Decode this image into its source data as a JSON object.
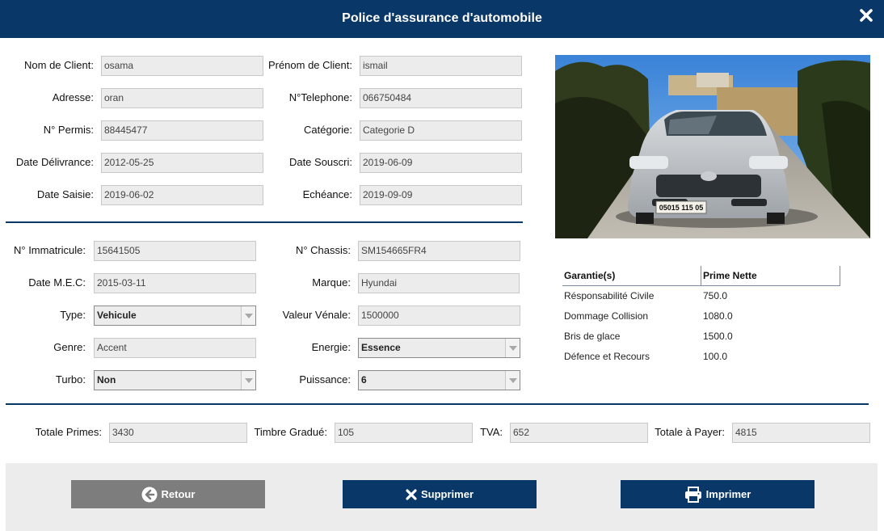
{
  "window": {
    "title": "Police d'assurance d'automobile"
  },
  "client": {
    "nom_label": "Nom de Client:",
    "nom_value": "osama",
    "prenom_label": "Prénom de Client:",
    "prenom_value": "ismail",
    "adresse_label": "Adresse:",
    "adresse_value": "oran",
    "telephone_label": "N°Telephone:",
    "telephone_value": "066750484",
    "permis_label": "N° Permis:",
    "permis_value": "88445477",
    "categorie_label": "Catégorie:",
    "categorie_value": "Categorie D",
    "delivrance_label": "Date Délivrance:",
    "delivrance_value": "2012-05-25",
    "souscri_label": "Date Souscri:",
    "souscri_value": "2019-06-09",
    "saisie_label": "Date Saisie:",
    "saisie_value": "2019-06-02",
    "echeance_label": "Echéance:",
    "echeance_value": "2019-09-09"
  },
  "vehicle": {
    "immatricule_label": "N° Immatricule:",
    "immatricule_value": "15641505",
    "chassis_label": "N° Chassis:",
    "chassis_value": "SM154665FR4",
    "mec_label": "Date M.E.C:",
    "mec_value": "2015-03-11",
    "marque_label": "Marque:",
    "marque_value": "Hyundai",
    "type_label": "Type:",
    "type_value": "Vehicule",
    "valeur_label": "Valeur Vénale:",
    "valeur_value": "1500000",
    "genre_label": "Genre:",
    "genre_value": "Accent",
    "energie_label": "Energie:",
    "energie_value": "Essence",
    "turbo_label": "Turbo:",
    "turbo_value": "Non",
    "puissance_label": "Puissance:",
    "puissance_value": "6",
    "plate_text": "05015 115 05"
  },
  "garanties": {
    "col1": "Garantie(s)",
    "col2": "Prime Nette",
    "rows": [
      {
        "name": "Résponsabilité Civile",
        "prime": "750.0"
      },
      {
        "name": "Dommage Collision",
        "prime": "1080.0"
      },
      {
        "name": "Bris de glace",
        "prime": "1500.0"
      },
      {
        "name": "Défence et Recours",
        "prime": "100.0"
      }
    ]
  },
  "totals": {
    "primes_label": "Totale Primes:",
    "primes_value": "3430",
    "timbre_label": "Timbre Gradué:",
    "timbre_value": "105",
    "tva_label": "TVA:",
    "tva_value": "652",
    "payer_label": "Totale à Payer:",
    "payer_value": "4815"
  },
  "buttons": {
    "retour": "Retour",
    "supprimer": "Supprimer",
    "imprimer": "Imprimer"
  },
  "icons": {
    "close": "close-icon",
    "retour": "arrow-left-circle-icon",
    "supprimer": "x-icon",
    "imprimer": "printer-icon"
  },
  "colors": {
    "header": "#083768",
    "button_gray": "#7d7d7d",
    "field_bg": "#ececec"
  }
}
